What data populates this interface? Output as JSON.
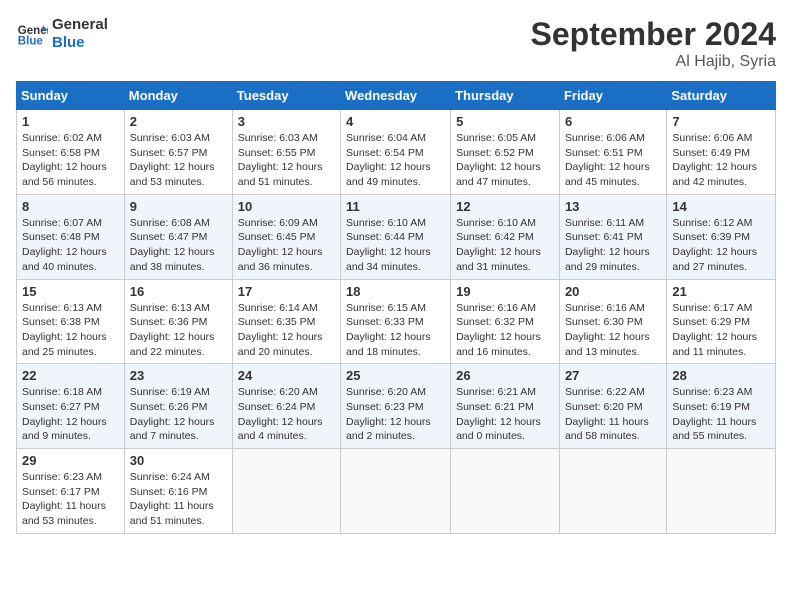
{
  "header": {
    "logo_line1": "General",
    "logo_line2": "Blue",
    "month": "September 2024",
    "location": "Al Hajib, Syria"
  },
  "weekdays": [
    "Sunday",
    "Monday",
    "Tuesday",
    "Wednesday",
    "Thursday",
    "Friday",
    "Saturday"
  ],
  "weeks": [
    [
      {
        "day": "1",
        "info": "Sunrise: 6:02 AM\nSunset: 6:58 PM\nDaylight: 12 hours\nand 56 minutes."
      },
      {
        "day": "2",
        "info": "Sunrise: 6:03 AM\nSunset: 6:57 PM\nDaylight: 12 hours\nand 53 minutes."
      },
      {
        "day": "3",
        "info": "Sunrise: 6:03 AM\nSunset: 6:55 PM\nDaylight: 12 hours\nand 51 minutes."
      },
      {
        "day": "4",
        "info": "Sunrise: 6:04 AM\nSunset: 6:54 PM\nDaylight: 12 hours\nand 49 minutes."
      },
      {
        "day": "5",
        "info": "Sunrise: 6:05 AM\nSunset: 6:52 PM\nDaylight: 12 hours\nand 47 minutes."
      },
      {
        "day": "6",
        "info": "Sunrise: 6:06 AM\nSunset: 6:51 PM\nDaylight: 12 hours\nand 45 minutes."
      },
      {
        "day": "7",
        "info": "Sunrise: 6:06 AM\nSunset: 6:49 PM\nDaylight: 12 hours\nand 42 minutes."
      }
    ],
    [
      {
        "day": "8",
        "info": "Sunrise: 6:07 AM\nSunset: 6:48 PM\nDaylight: 12 hours\nand 40 minutes."
      },
      {
        "day": "9",
        "info": "Sunrise: 6:08 AM\nSunset: 6:47 PM\nDaylight: 12 hours\nand 38 minutes."
      },
      {
        "day": "10",
        "info": "Sunrise: 6:09 AM\nSunset: 6:45 PM\nDaylight: 12 hours\nand 36 minutes."
      },
      {
        "day": "11",
        "info": "Sunrise: 6:10 AM\nSunset: 6:44 PM\nDaylight: 12 hours\nand 34 minutes."
      },
      {
        "day": "12",
        "info": "Sunrise: 6:10 AM\nSunset: 6:42 PM\nDaylight: 12 hours\nand 31 minutes."
      },
      {
        "day": "13",
        "info": "Sunrise: 6:11 AM\nSunset: 6:41 PM\nDaylight: 12 hours\nand 29 minutes."
      },
      {
        "day": "14",
        "info": "Sunrise: 6:12 AM\nSunset: 6:39 PM\nDaylight: 12 hours\nand 27 minutes."
      }
    ],
    [
      {
        "day": "15",
        "info": "Sunrise: 6:13 AM\nSunset: 6:38 PM\nDaylight: 12 hours\nand 25 minutes."
      },
      {
        "day": "16",
        "info": "Sunrise: 6:13 AM\nSunset: 6:36 PM\nDaylight: 12 hours\nand 22 minutes."
      },
      {
        "day": "17",
        "info": "Sunrise: 6:14 AM\nSunset: 6:35 PM\nDaylight: 12 hours\nand 20 minutes."
      },
      {
        "day": "18",
        "info": "Sunrise: 6:15 AM\nSunset: 6:33 PM\nDaylight: 12 hours\nand 18 minutes."
      },
      {
        "day": "19",
        "info": "Sunrise: 6:16 AM\nSunset: 6:32 PM\nDaylight: 12 hours\nand 16 minutes."
      },
      {
        "day": "20",
        "info": "Sunrise: 6:16 AM\nSunset: 6:30 PM\nDaylight: 12 hours\nand 13 minutes."
      },
      {
        "day": "21",
        "info": "Sunrise: 6:17 AM\nSunset: 6:29 PM\nDaylight: 12 hours\nand 11 minutes."
      }
    ],
    [
      {
        "day": "22",
        "info": "Sunrise: 6:18 AM\nSunset: 6:27 PM\nDaylight: 12 hours\nand 9 minutes."
      },
      {
        "day": "23",
        "info": "Sunrise: 6:19 AM\nSunset: 6:26 PM\nDaylight: 12 hours\nand 7 minutes."
      },
      {
        "day": "24",
        "info": "Sunrise: 6:20 AM\nSunset: 6:24 PM\nDaylight: 12 hours\nand 4 minutes."
      },
      {
        "day": "25",
        "info": "Sunrise: 6:20 AM\nSunset: 6:23 PM\nDaylight: 12 hours\nand 2 minutes."
      },
      {
        "day": "26",
        "info": "Sunrise: 6:21 AM\nSunset: 6:21 PM\nDaylight: 12 hours\nand 0 minutes."
      },
      {
        "day": "27",
        "info": "Sunrise: 6:22 AM\nSunset: 6:20 PM\nDaylight: 11 hours\nand 58 minutes."
      },
      {
        "day": "28",
        "info": "Sunrise: 6:23 AM\nSunset: 6:19 PM\nDaylight: 11 hours\nand 55 minutes."
      }
    ],
    [
      {
        "day": "29",
        "info": "Sunrise: 6:23 AM\nSunset: 6:17 PM\nDaylight: 11 hours\nand 53 minutes."
      },
      {
        "day": "30",
        "info": "Sunrise: 6:24 AM\nSunset: 6:16 PM\nDaylight: 11 hours\nand 51 minutes."
      },
      {
        "day": "",
        "info": ""
      },
      {
        "day": "",
        "info": ""
      },
      {
        "day": "",
        "info": ""
      },
      {
        "day": "",
        "info": ""
      },
      {
        "day": "",
        "info": ""
      }
    ]
  ]
}
